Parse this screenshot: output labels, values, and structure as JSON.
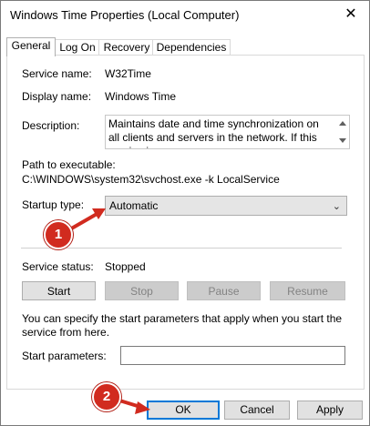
{
  "window": {
    "title": "Windows Time Properties (Local Computer)",
    "close_glyph": "✕"
  },
  "tabs": [
    {
      "label": "General",
      "active": true
    },
    {
      "label": "Log On",
      "active": false
    },
    {
      "label": "Recovery",
      "active": false
    },
    {
      "label": "Dependencies",
      "active": false
    }
  ],
  "general": {
    "service_name_label": "Service name:",
    "service_name_value": "W32Time",
    "display_name_label": "Display name:",
    "display_name_value": "Windows Time",
    "description_label": "Description:",
    "description_value": "Maintains date and time synchronization on all clients and servers in the network. If this service is",
    "path_label": "Path to executable:",
    "path_value": "C:\\WINDOWS\\system32\\svchost.exe -k LocalService",
    "startup_type_label": "Startup type:",
    "startup_type_value": "Automatic",
    "service_status_label": "Service status:",
    "service_status_value": "Stopped",
    "buttons": {
      "start": "Start",
      "stop": "Stop",
      "pause": "Pause",
      "resume": "Resume"
    },
    "start_params_note": "You can specify the start parameters that apply when you start the service from here.",
    "start_params_label": "Start parameters:",
    "start_params_value": ""
  },
  "footer": {
    "ok": "OK",
    "cancel": "Cancel",
    "apply": "Apply"
  },
  "annotations": {
    "badge1": "1",
    "badge2": "2",
    "color": "#d12b1f"
  },
  "icons": {
    "dropdown": "chevron-down-icon",
    "scroll_up": "arrow-up-icon",
    "scroll_down": "arrow-down-icon"
  }
}
